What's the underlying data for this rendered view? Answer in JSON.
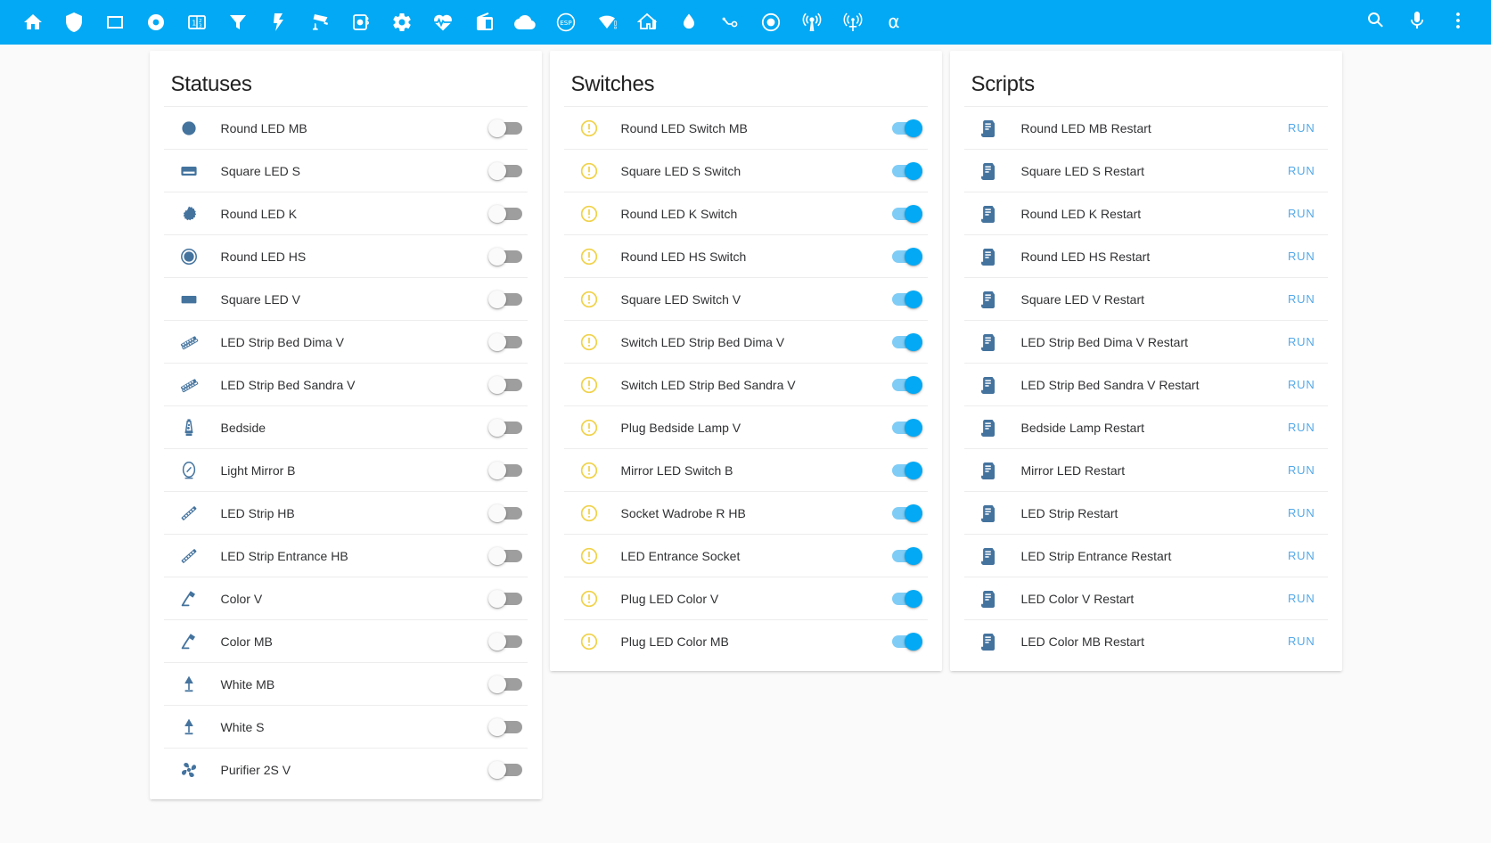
{
  "app_bar": {
    "tabs": [
      {
        "icon": "home-icon",
        "name": "tab-home"
      },
      {
        "icon": "shield-icon",
        "name": "tab-shield"
      },
      {
        "icon": "square-outline-icon",
        "name": "tab-square-outline"
      },
      {
        "icon": "record-circle-icon",
        "name": "tab-record-circle"
      },
      {
        "icon": "counter-icon",
        "name": "tab-counter"
      },
      {
        "icon": "filter-icon",
        "name": "tab-filter"
      },
      {
        "icon": "flash-icon",
        "name": "tab-flash"
      },
      {
        "icon": "cctv-icon",
        "name": "tab-cctv"
      },
      {
        "icon": "camera-iris-icon",
        "name": "tab-camera-iris"
      },
      {
        "icon": "cog-icon",
        "name": "tab-cog"
      },
      {
        "icon": "heart-pulse-icon",
        "name": "tab-heart-pulse"
      },
      {
        "icon": "radio-icon",
        "name": "tab-radio"
      },
      {
        "icon": "cloud-icon",
        "name": "tab-cloud"
      },
      {
        "icon": "esp-icon",
        "name": "tab-esp"
      },
      {
        "icon": "wifi-alert-icon",
        "name": "tab-wifi-alert"
      },
      {
        "icon": "home-thermometer-icon",
        "name": "tab-home-thermometer"
      },
      {
        "icon": "water-icon",
        "name": "tab-water"
      },
      {
        "icon": "toggle-switch-icon",
        "name": "tab-toggle-switch"
      },
      {
        "icon": "record-icon",
        "name": "tab-record"
      },
      {
        "icon": "broadcast-icon",
        "name": "tab-broadcast"
      },
      {
        "icon": "antenna-icon",
        "name": "tab-antenna"
      },
      {
        "icon": "alpha-icon",
        "name": "tab-alpha",
        "label": "α"
      }
    ],
    "actions": [
      {
        "icon": "search-icon",
        "name": "search-button"
      },
      {
        "icon": "microphone-icon",
        "name": "voice-assistant-button"
      },
      {
        "icon": "overflow-menu-icon",
        "name": "overflow-menu-button"
      }
    ]
  },
  "colors": {
    "app_bar": "#03a9f4",
    "page_background": "#fafafa",
    "card_background": "#ffffff",
    "entity_icon": "#44739e",
    "warning_icon": "#f0d24a",
    "toggle_on": "#03a9f4",
    "toggle_off": "#9e9e9e",
    "run_link": "#54a9e8",
    "header_text": "#212121",
    "row_text": "#303133"
  },
  "cards": [
    {
      "title": "Statuses",
      "name": "statuses-card",
      "control": "toggle",
      "rows": [
        {
          "label": "Round LED MB",
          "icon": "circle-icon",
          "state": "off"
        },
        {
          "label": "Square LED S",
          "icon": "card-outline-icon",
          "state": "off"
        },
        {
          "label": "Round LED K",
          "icon": "gear-circle-icon",
          "state": "off"
        },
        {
          "label": "Round LED HS",
          "icon": "circle-ring-icon",
          "state": "off"
        },
        {
          "label": "Square LED V",
          "icon": "rectangle-icon",
          "state": "off"
        },
        {
          "label": "LED Strip Bed Dima V",
          "icon": "led-strip-icon",
          "state": "off"
        },
        {
          "label": "LED Strip Bed Sandra V",
          "icon": "led-strip-icon",
          "state": "off"
        },
        {
          "label": "Bedside",
          "icon": "lava-lamp-icon",
          "state": "off"
        },
        {
          "label": "Light Mirror B",
          "icon": "mirror-icon",
          "state": "off"
        },
        {
          "label": "LED Strip HB",
          "icon": "led-strip-variant-icon",
          "state": "off"
        },
        {
          "label": "LED Strip Entrance HB",
          "icon": "led-strip-variant-icon",
          "state": "off"
        },
        {
          "label": "Color V",
          "icon": "desk-lamp-icon",
          "state": "off"
        },
        {
          "label": "Color MB",
          "icon": "desk-lamp-icon",
          "state": "off"
        },
        {
          "label": "White MB",
          "icon": "table-lamp-icon",
          "state": "off"
        },
        {
          "label": "White S",
          "icon": "table-lamp-icon",
          "state": "off"
        },
        {
          "label": "Purifier 2S V",
          "icon": "fan-icon",
          "state": "off"
        }
      ]
    },
    {
      "title": "Switches",
      "name": "switches-card",
      "control": "toggle",
      "rows": [
        {
          "label": "Round LED Switch MB",
          "icon": "alert-power-icon",
          "state": "on"
        },
        {
          "label": "Square LED S Switch",
          "icon": "alert-power-icon",
          "state": "on"
        },
        {
          "label": "Round LED K Switch",
          "icon": "alert-power-icon",
          "state": "on"
        },
        {
          "label": "Round LED HS Switch",
          "icon": "alert-power-icon",
          "state": "on"
        },
        {
          "label": "Square LED Switch V",
          "icon": "alert-power-icon",
          "state": "on"
        },
        {
          "label": "Switch LED Strip Bed Dima V",
          "icon": "alert-power-icon",
          "state": "on"
        },
        {
          "label": "Switch LED Strip Bed Sandra V",
          "icon": "alert-power-icon",
          "state": "on"
        },
        {
          "label": "Plug Bedside Lamp V",
          "icon": "alert-power-icon",
          "state": "on"
        },
        {
          "label": "Mirror LED Switch B",
          "icon": "alert-power-icon",
          "state": "on"
        },
        {
          "label": "Socket Wadrobe R HB",
          "icon": "alert-power-icon",
          "state": "on"
        },
        {
          "label": "LED Entrance Socket",
          "icon": "alert-power-icon",
          "state": "on"
        },
        {
          "label": "Plug LED Color V",
          "icon": "alert-power-icon",
          "state": "on"
        },
        {
          "label": "Plug LED Color MB",
          "icon": "alert-power-icon",
          "state": "on"
        }
      ]
    },
    {
      "title": "Scripts",
      "name": "scripts-card",
      "control": "run",
      "run_label": "RUN",
      "rows": [
        {
          "label": "Round LED MB Restart",
          "icon": "script-icon",
          "action": "RUN"
        },
        {
          "label": "Square LED S Restart",
          "icon": "script-icon",
          "action": "RUN"
        },
        {
          "label": "Round LED K Restart",
          "icon": "script-icon",
          "action": "RUN"
        },
        {
          "label": "Round LED HS Restart",
          "icon": "script-icon",
          "action": "RUN"
        },
        {
          "label": "Square LED V Restart",
          "icon": "script-icon",
          "action": "RUN"
        },
        {
          "label": "LED Strip Bed Dima V Restart",
          "icon": "script-icon",
          "action": "RUN"
        },
        {
          "label": "LED Strip Bed Sandra V Restart",
          "icon": "script-icon",
          "action": "RUN"
        },
        {
          "label": "Bedside Lamp Restart",
          "icon": "script-icon",
          "action": "RUN"
        },
        {
          "label": "Mirror LED Restart",
          "icon": "script-icon",
          "action": "RUN"
        },
        {
          "label": "LED Strip Restart",
          "icon": "script-icon",
          "action": "RUN"
        },
        {
          "label": "LED Strip Entrance Restart",
          "icon": "script-icon",
          "action": "RUN"
        },
        {
          "label": "LED Color V Restart",
          "icon": "script-icon",
          "action": "RUN"
        },
        {
          "label": "LED Color MB Restart",
          "icon": "script-icon",
          "action": "RUN"
        }
      ]
    }
  ]
}
